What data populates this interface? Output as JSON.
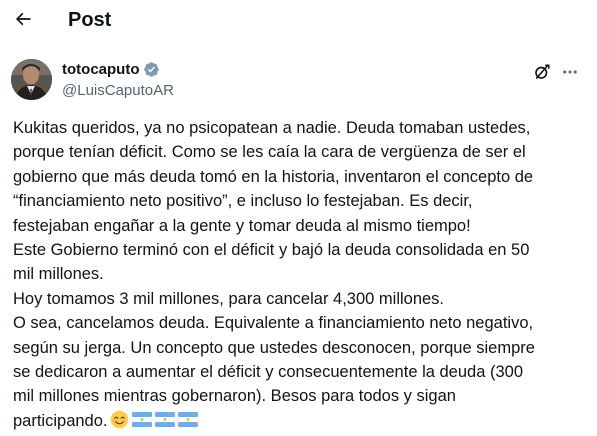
{
  "header": {
    "title": "Post",
    "back_icon": "arrow-left-icon"
  },
  "author": {
    "name": "totocaputo",
    "handle": "@LuisCaputoAR",
    "verified_icon": "verified-badge-icon",
    "verified_color": "#829aab"
  },
  "actions": {
    "grok_icon": "grok-icon",
    "more_icon": "more-options-icon"
  },
  "post": {
    "lines": [
      "Kukitas queridos, ya no psicopatean a nadie. Deuda tomaban ustedes,",
      "porque tenían déficit. Como se les caía la cara de vergüenza de ser el",
      "gobierno que más deuda tomó en la historia, inventaron el concepto de",
      "“financiamiento neto positivo”, e incluso lo festejaban. Es decir,",
      "festejaban engañar a la gente y tomar deuda al mismo tiempo!",
      "Este Gobierno terminó con el déficit y bajó la deuda consolidada en 50",
      "mil millones.",
      "Hoy tomamos 3 mil millones, para cancelar 4,300 millones.",
      "O sea, cancelamos deuda. Equivalente a financiamiento neto negativo,",
      "según su jerga. Un concepto que ustedes desconocen, porque siempre",
      "se dedicaron a aumentar el déficit y consecuentemente la deuda (300",
      "mil millones mientras gobernaron). Besos para todos y sigan",
      "participando."
    ],
    "emojis": [
      "smiling-face-emoji",
      "argentina-flag-emoji",
      "argentina-flag-emoji",
      "argentina-flag-emoji"
    ]
  },
  "colors": {
    "text": "#0f1419",
    "secondary": "#536471",
    "flag_blue": "#74acdf",
    "flag_sun": "#f6b40e"
  }
}
